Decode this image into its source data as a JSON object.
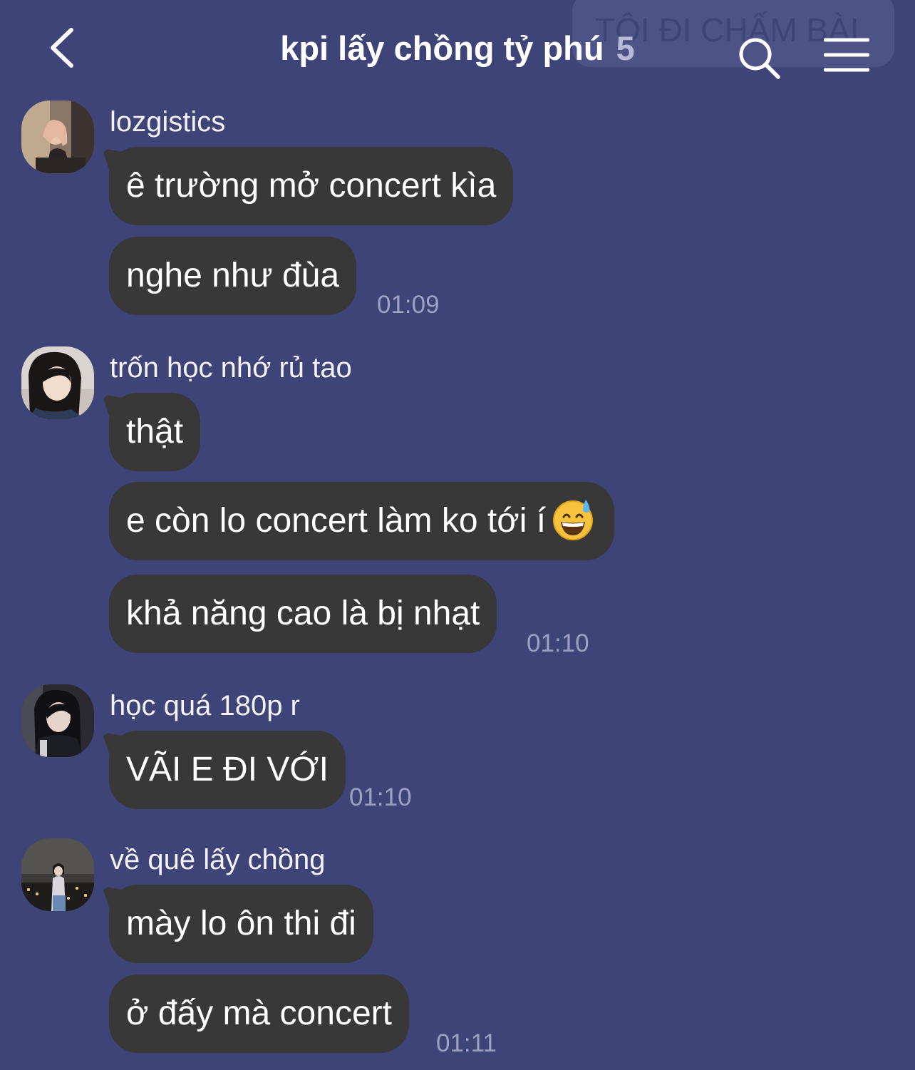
{
  "pinned_note": "TÔI ĐI CHẤM BÀI",
  "header": {
    "title": "kpi lấy chồng tỷ phú",
    "member_count": "5"
  },
  "messages": [
    {
      "sender": "lozgistics",
      "bubbles": [
        "ê trường mở concert kìa",
        "nghe như đùa"
      ],
      "time": "01:09"
    },
    {
      "sender": "trốn học nhớ rủ tao",
      "bubbles": [
        "thật",
        "e còn lo concert làm ko tới í",
        "khả năng cao là bị nhạt"
      ],
      "emoji": "grinning-sweat-emoji",
      "time": "01:10"
    },
    {
      "sender": "học quá 180p r",
      "bubbles": [
        "VÃI E ĐI VỚI"
      ],
      "time": "01:10"
    },
    {
      "sender": "về quê lấy chồng",
      "bubbles": [
        "mày lo ôn thi đi",
        "ở đấy mà concert"
      ],
      "time": "01:11"
    }
  ],
  "colors": {
    "background": "#3f4478",
    "bubble": "#383838",
    "timestamp": "#9da1c2"
  }
}
